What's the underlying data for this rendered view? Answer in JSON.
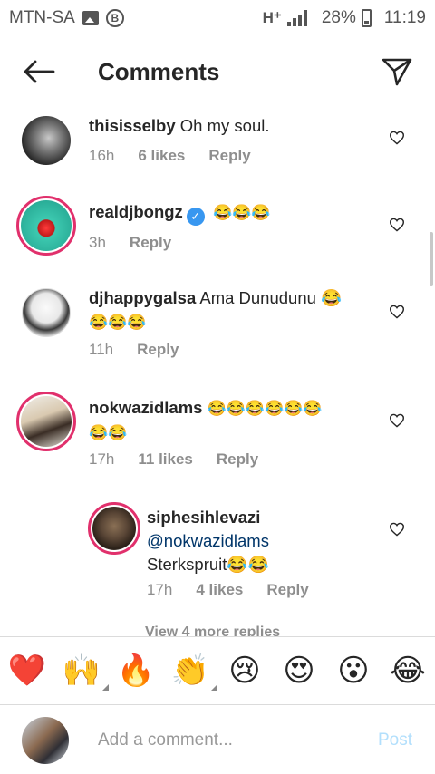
{
  "status_bar": {
    "carrier": "MTN-SA",
    "network": "H⁺",
    "battery": "28%",
    "time": "11:19"
  },
  "header": {
    "title": "Comments",
    "back_icon": "arrow-left-icon",
    "send_icon": "paper-plane-icon"
  },
  "comments": [
    {
      "username": "thisisselby",
      "text": "Oh my soul.",
      "time": "16h",
      "likes": "6 likes",
      "reply": "Reply"
    },
    {
      "username": "realdjbongz",
      "verified": true,
      "text": "😂😂😂",
      "time": "3h",
      "reply": "Reply"
    },
    {
      "username": "djhappygalsa",
      "text": "Ama Dunudunu 😂",
      "text_line2": "😂😂😂",
      "time": "11h",
      "reply": "Reply"
    },
    {
      "username": "nokwazidlams",
      "text": "😂😂😂😂😂😂",
      "text_line2": "😂😂",
      "time": "17h",
      "likes": "11 likes",
      "reply": "Reply"
    },
    {
      "username": "siphesihlevazi",
      "mention": "@nokwazidlams",
      "text": "Sterkspruit😂😂",
      "time": "17h",
      "likes": "4 likes",
      "reply": "Reply"
    }
  ],
  "view_more": "View 4 more replies",
  "emoji_bar": [
    "❤️",
    "🙌",
    "🔥",
    "👏",
    "😢",
    "😍",
    "😮",
    "😂"
  ],
  "input": {
    "placeholder": "Add a comment...",
    "post_label": "Post"
  },
  "colors": {
    "accent": "#3897f0",
    "post_disabled": "#b2dffc",
    "story_ring": "#e1306c"
  }
}
